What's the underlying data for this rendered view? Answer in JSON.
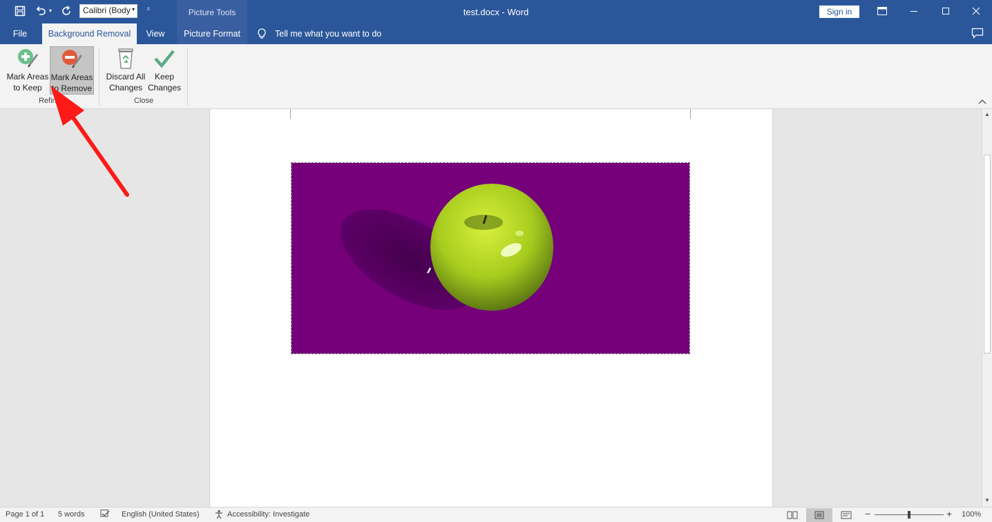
{
  "window": {
    "title": "test.docx  -  Word",
    "sign_in": "Sign in"
  },
  "qat": {
    "font_name": "Calibri (Body"
  },
  "context_tab_group": "Picture Tools",
  "tabs": [
    {
      "label": "File"
    },
    {
      "label": "Background Removal"
    },
    {
      "label": "View"
    },
    {
      "label": "Picture Format"
    }
  ],
  "tell_me": "Tell me what you want to do",
  "ribbon": {
    "refine": {
      "label": "Refine",
      "mark_keep_line1": "Mark Areas",
      "mark_keep_line2": "to Keep",
      "mark_remove_line1": "Mark Areas",
      "mark_remove_line2": "to Remove"
    },
    "close": {
      "label": "Close",
      "discard_line1": "Discard All",
      "discard_line2": "Changes",
      "keep_line1": "Keep",
      "keep_line2": "Changes"
    }
  },
  "status": {
    "page": "Page 1 of 1",
    "words": "5 words",
    "language": "English (United States)",
    "accessibility": "Accessibility: Investigate",
    "zoom": "100%"
  },
  "colors": {
    "brand": "#2b579a",
    "picture_background": "#7a007a",
    "annotation_arrow": "#ff1a1a"
  },
  "icons": [
    "save-icon",
    "undo-icon",
    "redo-icon",
    "lightbulb-icon",
    "comment-icon",
    "restore-ribbon-icon",
    "minimize-icon",
    "maximize-icon",
    "close-icon",
    "mark-keep-icon",
    "mark-remove-icon",
    "discard-icon",
    "keep-changes-icon",
    "proofing-icon",
    "accessibility-icon",
    "read-mode-icon",
    "print-layout-icon",
    "web-layout-icon"
  ]
}
